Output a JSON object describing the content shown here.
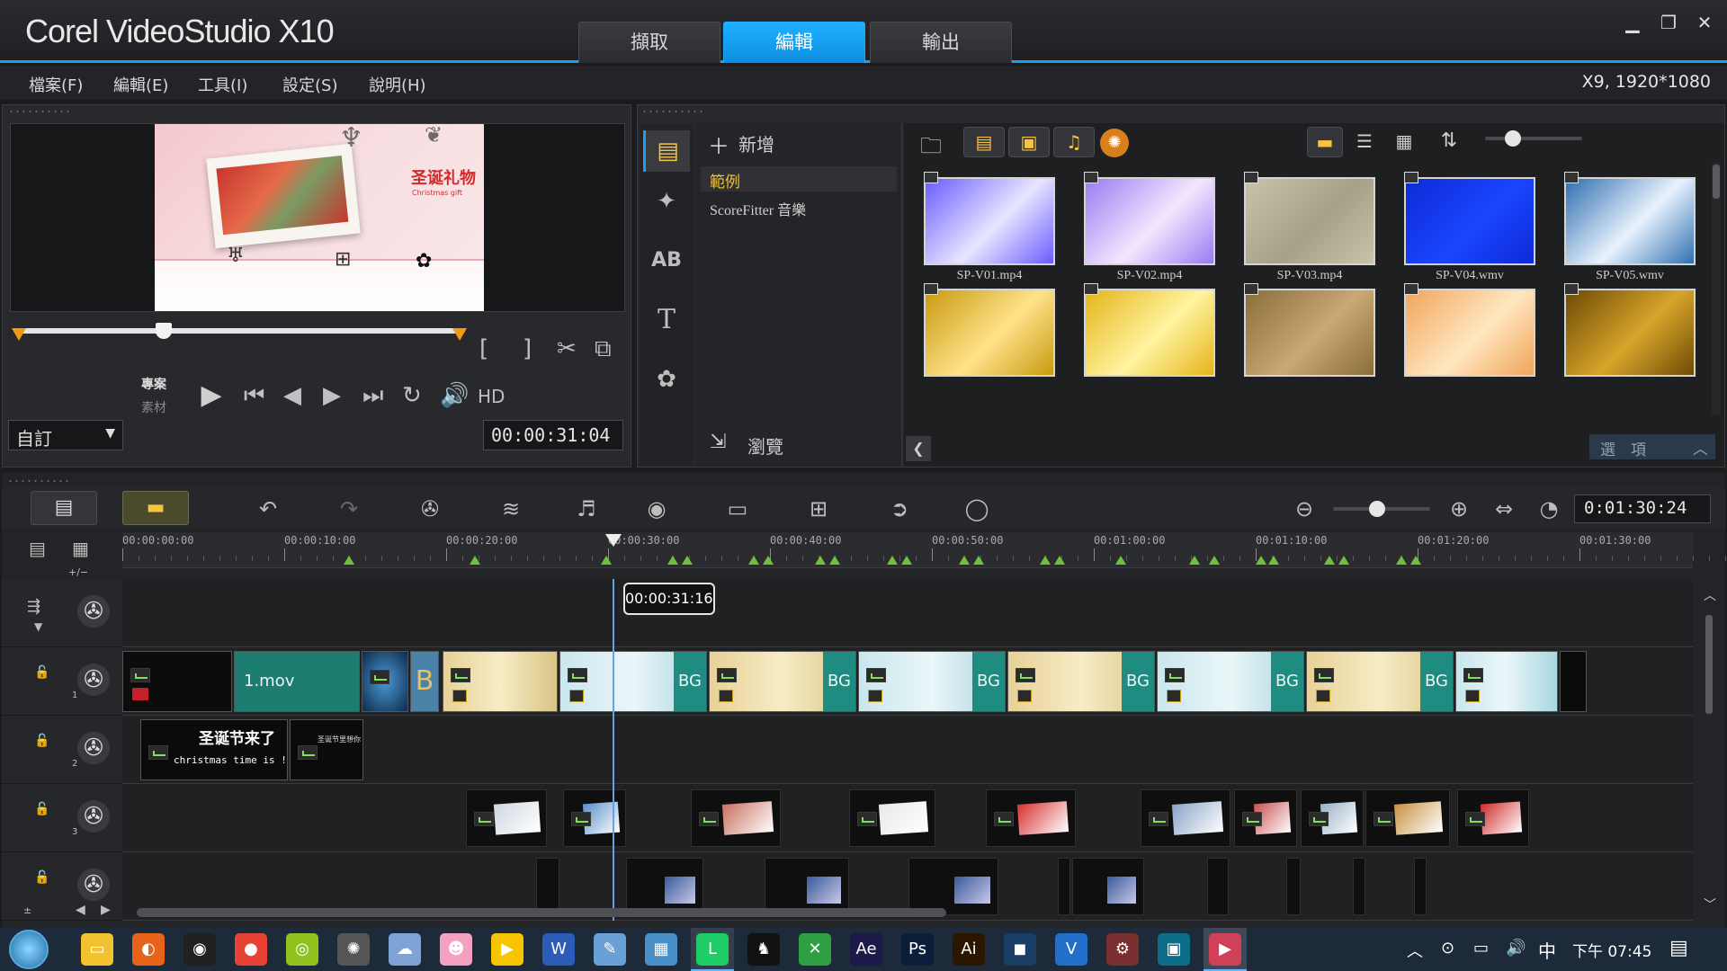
{
  "window": {
    "title": "Corel VideoStudio X10",
    "project_info": "X9, 1920*1080"
  },
  "main_tabs": [
    {
      "label": "擷取"
    },
    {
      "label": "編輯"
    },
    {
      "label": "輸出"
    }
  ],
  "menu": [
    {
      "label": "檔案(F)"
    },
    {
      "label": "編輯(E)"
    },
    {
      "label": "工具(I)"
    },
    {
      "label": "設定(S)"
    },
    {
      "label": "說明(H)"
    }
  ],
  "preview": {
    "title_text": "圣诞礼物",
    "subtitle_text": "Christmas gift",
    "mode_project": "專案",
    "mode_clip": "素材",
    "hd_label": "HD",
    "aspect_select": "自訂",
    "timecode": "00:00:31:04",
    "scrubber_position": 0.33
  },
  "library": {
    "add_label": "新增",
    "folders": [
      {
        "label": "範例",
        "selected": true
      },
      {
        "label": "ScoreFitter 音樂",
        "selected": false
      }
    ],
    "browse_label": "瀏覽",
    "options_label": "選　項",
    "thumbnails": [
      {
        "label": "SP-V01.mp4",
        "colors": [
          "#6a5cff",
          "#e8e6ff"
        ]
      },
      {
        "label": "SP-V02.mp4",
        "colors": [
          "#9a7cf0",
          "#f4e6ff"
        ]
      },
      {
        "label": "SP-V03.mp4",
        "colors": [
          "#c9c3a8",
          "#a8a18a"
        ]
      },
      {
        "label": "SP-V04.wmv",
        "colors": [
          "#0d2bd6",
          "#1a45ff"
        ]
      },
      {
        "label": "SP-V05.wmv",
        "colors": [
          "#2f6fae",
          "#e9f3ff"
        ]
      },
      {
        "label": "",
        "colors": [
          "#c89a10",
          "#ffe38a"
        ]
      },
      {
        "label": "",
        "colors": [
          "#e6b41a",
          "#fff4a0"
        ]
      },
      {
        "label": "",
        "colors": [
          "#8a6e3a",
          "#c9a874"
        ]
      },
      {
        "label": "",
        "colors": [
          "#f1a55a",
          "#ffe7c0"
        ]
      },
      {
        "label": "",
        "colors": [
          "#6e4a06",
          "#d7a52a"
        ]
      }
    ]
  },
  "timeline": {
    "duration_display": "0:01:30:24",
    "ruler_labels": [
      "00:00:00:00",
      "00:00:10:00",
      "00:00:20:00",
      "00:00:30:00",
      "00:00:40:00",
      "00:00:50:00",
      "00:01:00:00",
      "00:01:10:00",
      "00:01:20:00",
      "00:01:30:00"
    ],
    "playhead_time": "00:00:31:16",
    "playhead_fraction": 0.312,
    "zoom_fraction": 0.45,
    "track_numbers": [
      "",
      "1",
      "2",
      "3",
      ""
    ],
    "main_clip_label": "1.mov",
    "bg_tag": "BG",
    "title_clip_text": "圣诞节来了",
    "title_clip_sub": "christmas time is !",
    "title_clip2_text": "圣诞节里想你",
    "zoom_in_label": "+/−",
    "zoom_out_label": "±"
  },
  "taskbar": {
    "time": "下午 07:45",
    "ime": "中",
    "apps": [
      {
        "name": "file-explorer-icon",
        "color": "#f2c230",
        "glyph": "▭"
      },
      {
        "name": "firefox-icon",
        "color": "#e8631a",
        "glyph": "◐"
      },
      {
        "name": "app-icon",
        "color": "#202020",
        "glyph": "◉"
      },
      {
        "name": "chrome-icon",
        "color": "#e94235",
        "glyph": "●"
      },
      {
        "name": "app-green-icon",
        "color": "#8fc21d",
        "glyph": "◎"
      },
      {
        "name": "settings-icon",
        "color": "#555",
        "glyph": "✺"
      },
      {
        "name": "app-cloud-icon",
        "color": "#7fa3d4",
        "glyph": "☁"
      },
      {
        "name": "anime-icon",
        "color": "#f4a0c0",
        "glyph": "☻"
      },
      {
        "name": "media-icon",
        "color": "#f7c400",
        "glyph": "▶"
      },
      {
        "name": "word-icon",
        "color": "#2b5cb8",
        "glyph": "W"
      },
      {
        "name": "app-brush-icon",
        "color": "#6aa0d8",
        "glyph": "✎"
      },
      {
        "name": "picture-icon",
        "color": "#4a90c8",
        "glyph": "▦"
      },
      {
        "name": "line-icon",
        "color": "#06c755",
        "glyph": "L"
      },
      {
        "name": "qq-icon",
        "color": "#111",
        "glyph": "♞"
      },
      {
        "name": "xbox-icon",
        "color": "#2ea043",
        "glyph": "✕"
      },
      {
        "name": "aftereffects-icon",
        "color": "#1d1a4a",
        "glyph": "Ae"
      },
      {
        "name": "photoshop-icon",
        "color": "#0b1f3a",
        "glyph": "Ps"
      },
      {
        "name": "illustrator-icon",
        "color": "#2b1700",
        "glyph": "Ai"
      },
      {
        "name": "camera-icon",
        "color": "#1b3e66",
        "glyph": "◼"
      },
      {
        "name": "vsco-icon",
        "color": "#2170c9",
        "glyph": "V"
      },
      {
        "name": "app-red-icon",
        "color": "#7a2e2e",
        "glyph": "⚙"
      },
      {
        "name": "monitor-icon",
        "color": "#0d6e8a",
        "glyph": "▣"
      },
      {
        "name": "videostudio-icon",
        "color": "#c8203a",
        "glyph": "▶"
      }
    ]
  }
}
